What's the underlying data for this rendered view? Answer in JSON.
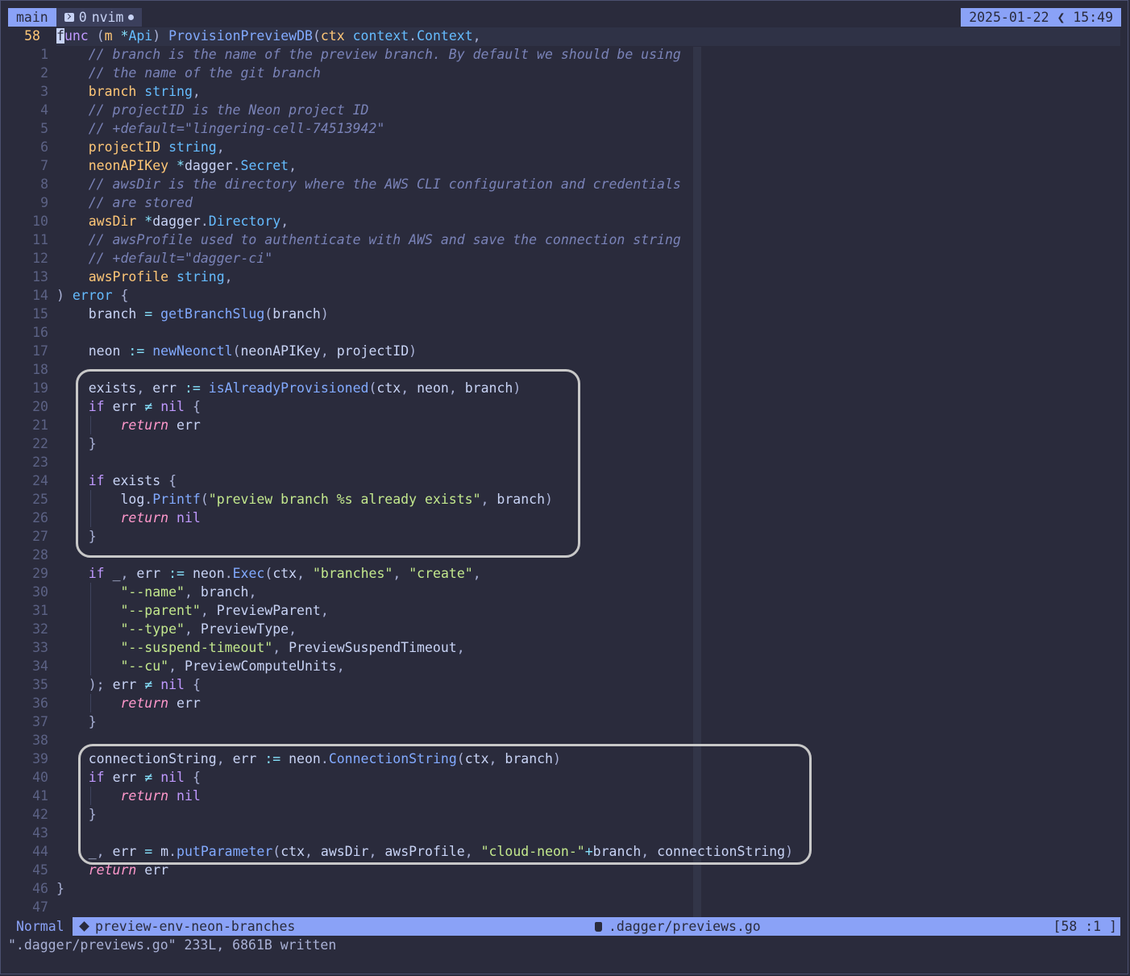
{
  "tmux": {
    "session": "main",
    "window_index": "0",
    "window_name": "nvim",
    "clock": "2025-01-22 ❮ 15:49"
  },
  "editor": {
    "lines": [
      {
        "n": "58",
        "tokens": [
          [
            "cursor",
            "f"
          ],
          [
            "kw",
            "unc "
          ],
          [
            "pu",
            "("
          ],
          [
            "pm",
            "m "
          ],
          [
            "op",
            "*"
          ],
          [
            "ty",
            "Api"
          ],
          [
            "pu",
            ") "
          ],
          [
            "fn",
            "ProvisionPreviewDB"
          ],
          [
            "pu",
            "("
          ],
          [
            "pm",
            "ctx "
          ],
          [
            "ty",
            "context"
          ],
          [
            "pu",
            "."
          ],
          [
            "ty",
            "Context"
          ],
          [
            "pu",
            ","
          ]
        ]
      },
      {
        "n": "1",
        "tokens": [
          [
            "",
            "    "
          ],
          [
            "cm",
            "// branch is the name of the preview branch. By default we should be using"
          ]
        ]
      },
      {
        "n": "2",
        "tokens": [
          [
            "",
            "    "
          ],
          [
            "cm",
            "// the name of the git branch"
          ]
        ]
      },
      {
        "n": "3",
        "tokens": [
          [
            "",
            "    "
          ],
          [
            "pm",
            "branch "
          ],
          [
            "ty",
            "string"
          ],
          [
            "pu",
            ","
          ]
        ]
      },
      {
        "n": "4",
        "tokens": [
          [
            "",
            "    "
          ],
          [
            "cm",
            "// projectID is the Neon project ID"
          ]
        ]
      },
      {
        "n": "5",
        "tokens": [
          [
            "",
            "    "
          ],
          [
            "cm",
            "// +default=\"lingering-cell-74513942\""
          ]
        ]
      },
      {
        "n": "6",
        "tokens": [
          [
            "",
            "    "
          ],
          [
            "pm",
            "projectID "
          ],
          [
            "ty",
            "string"
          ],
          [
            "pu",
            ","
          ]
        ]
      },
      {
        "n": "7",
        "tokens": [
          [
            "",
            "    "
          ],
          [
            "pm",
            "neonAPIKey "
          ],
          [
            "op",
            "*"
          ],
          [
            "",
            "dagger"
          ],
          [
            "pu",
            "."
          ],
          [
            "ty",
            "Secret"
          ],
          [
            "pu",
            ","
          ]
        ]
      },
      {
        "n": "8",
        "tokens": [
          [
            "",
            "    "
          ],
          [
            "cm",
            "// awsDir is the directory where the AWS CLI configuration and credentials"
          ]
        ]
      },
      {
        "n": "9",
        "tokens": [
          [
            "",
            "    "
          ],
          [
            "cm",
            "// are stored"
          ]
        ]
      },
      {
        "n": "10",
        "tokens": [
          [
            "",
            "    "
          ],
          [
            "pm",
            "awsDir "
          ],
          [
            "op",
            "*"
          ],
          [
            "",
            "dagger"
          ],
          [
            "pu",
            "."
          ],
          [
            "ty",
            "Directory"
          ],
          [
            "pu",
            ","
          ]
        ]
      },
      {
        "n": "11",
        "tokens": [
          [
            "",
            "    "
          ],
          [
            "cm",
            "// awsProfile used to authenticate with AWS and save the connection string"
          ]
        ]
      },
      {
        "n": "12",
        "tokens": [
          [
            "",
            "    "
          ],
          [
            "cm",
            "// +default=\"dagger-ci\""
          ]
        ]
      },
      {
        "n": "13",
        "tokens": [
          [
            "",
            "    "
          ],
          [
            "pm",
            "awsProfile "
          ],
          [
            "ty",
            "string"
          ],
          [
            "pu",
            ","
          ]
        ]
      },
      {
        "n": "14",
        "tokens": [
          [
            "pu",
            ") "
          ],
          [
            "ty",
            "error "
          ],
          [
            "pu",
            "{"
          ]
        ]
      },
      {
        "n": "15",
        "tokens": [
          [
            "",
            "    branch "
          ],
          [
            "op",
            "= "
          ],
          [
            "fn",
            "getBranchSlug"
          ],
          [
            "pu",
            "("
          ],
          [
            "",
            "branch"
          ],
          [
            "pu",
            ")"
          ]
        ]
      },
      {
        "n": "16",
        "tokens": []
      },
      {
        "n": "17",
        "tokens": [
          [
            "",
            "    neon "
          ],
          [
            "op",
            ":= "
          ],
          [
            "fn",
            "newNeonctl"
          ],
          [
            "pu",
            "("
          ],
          [
            "",
            "neonAPIKey"
          ],
          [
            "pu",
            ", "
          ],
          [
            "",
            "projectID"
          ],
          [
            "pu",
            ")"
          ]
        ]
      },
      {
        "n": "18",
        "tokens": []
      },
      {
        "n": "19",
        "tokens": [
          [
            "",
            "    exists"
          ],
          [
            "pu",
            ", "
          ],
          [
            "",
            "err "
          ],
          [
            "op",
            ":= "
          ],
          [
            "fn",
            "isAlreadyProvisioned"
          ],
          [
            "pu",
            "("
          ],
          [
            "",
            "ctx"
          ],
          [
            "pu",
            ", "
          ],
          [
            "",
            "neon"
          ],
          [
            "pu",
            ", "
          ],
          [
            "",
            "branch"
          ],
          [
            "pu",
            ")"
          ]
        ]
      },
      {
        "n": "20",
        "tokens": [
          [
            "",
            "    "
          ],
          [
            "kw",
            "if "
          ],
          [
            "",
            "err "
          ],
          [
            "op",
            "≠ "
          ],
          [
            "nl",
            "nil "
          ],
          [
            "pu",
            "{"
          ]
        ]
      },
      {
        "n": "21",
        "tokens": [
          [
            "",
            "        "
          ],
          [
            "kwi",
            "return "
          ],
          [
            "",
            "err"
          ]
        ]
      },
      {
        "n": "22",
        "tokens": [
          [
            "",
            "    "
          ],
          [
            "pu",
            "}"
          ]
        ]
      },
      {
        "n": "23",
        "tokens": []
      },
      {
        "n": "24",
        "tokens": [
          [
            "",
            "    "
          ],
          [
            "kw",
            "if "
          ],
          [
            "",
            "exists "
          ],
          [
            "pu",
            "{"
          ]
        ]
      },
      {
        "n": "25",
        "tokens": [
          [
            "",
            "        log"
          ],
          [
            "pu",
            "."
          ],
          [
            "fn",
            "Printf"
          ],
          [
            "pu",
            "("
          ],
          [
            "st",
            "\"preview branch %s already exists\""
          ],
          [
            "pu",
            ", "
          ],
          [
            "",
            "branch"
          ],
          [
            "pu",
            ")"
          ]
        ]
      },
      {
        "n": "26",
        "tokens": [
          [
            "",
            "        "
          ],
          [
            "kwi",
            "return "
          ],
          [
            "nl",
            "nil"
          ]
        ]
      },
      {
        "n": "27",
        "tokens": [
          [
            "",
            "    "
          ],
          [
            "pu",
            "}"
          ]
        ]
      },
      {
        "n": "28",
        "tokens": []
      },
      {
        "n": "29",
        "tokens": [
          [
            "",
            "    "
          ],
          [
            "kw",
            "if "
          ],
          [
            "",
            "_"
          ],
          [
            "pu",
            ", "
          ],
          [
            "",
            "err "
          ],
          [
            "op",
            ":= "
          ],
          [
            "",
            "neon"
          ],
          [
            "pu",
            "."
          ],
          [
            "fn",
            "Exec"
          ],
          [
            "pu",
            "("
          ],
          [
            "",
            "ctx"
          ],
          [
            "pu",
            ", "
          ],
          [
            "st",
            "\"branches\""
          ],
          [
            "pu",
            ", "
          ],
          [
            "st",
            "\"create\""
          ],
          [
            "pu",
            ","
          ]
        ]
      },
      {
        "n": "30",
        "tokens": [
          [
            "",
            "        "
          ],
          [
            "st",
            "\"--name\""
          ],
          [
            "pu",
            ", "
          ],
          [
            "",
            "branch"
          ],
          [
            "pu",
            ","
          ]
        ]
      },
      {
        "n": "31",
        "tokens": [
          [
            "",
            "        "
          ],
          [
            "st",
            "\"--parent\""
          ],
          [
            "pu",
            ", "
          ],
          [
            "",
            "PreviewParent"
          ],
          [
            "pu",
            ","
          ]
        ]
      },
      {
        "n": "32",
        "tokens": [
          [
            "",
            "        "
          ],
          [
            "st",
            "\"--type\""
          ],
          [
            "pu",
            ", "
          ],
          [
            "",
            "PreviewType"
          ],
          [
            "pu",
            ","
          ]
        ]
      },
      {
        "n": "33",
        "tokens": [
          [
            "",
            "        "
          ],
          [
            "st",
            "\"--suspend-timeout\""
          ],
          [
            "pu",
            ", "
          ],
          [
            "",
            "PreviewSuspendTimeout"
          ],
          [
            "pu",
            ","
          ]
        ]
      },
      {
        "n": "34",
        "tokens": [
          [
            "",
            "        "
          ],
          [
            "st",
            "\"--cu\""
          ],
          [
            "pu",
            ", "
          ],
          [
            "",
            "PreviewComputeUnits"
          ],
          [
            "pu",
            ","
          ]
        ]
      },
      {
        "n": "35",
        "tokens": [
          [
            "",
            "    "
          ],
          [
            "pu",
            "); "
          ],
          [
            "",
            "err "
          ],
          [
            "op",
            "≠ "
          ],
          [
            "nl",
            "nil "
          ],
          [
            "pu",
            "{"
          ]
        ]
      },
      {
        "n": "36",
        "tokens": [
          [
            "",
            "        "
          ],
          [
            "kwi",
            "return "
          ],
          [
            "",
            "err"
          ]
        ]
      },
      {
        "n": "37",
        "tokens": [
          [
            "",
            "    "
          ],
          [
            "pu",
            "}"
          ]
        ]
      },
      {
        "n": "38",
        "tokens": []
      },
      {
        "n": "39",
        "tokens": [
          [
            "",
            "    connectionString"
          ],
          [
            "pu",
            ", "
          ],
          [
            "",
            "err "
          ],
          [
            "op",
            ":= "
          ],
          [
            "",
            "neon"
          ],
          [
            "pu",
            "."
          ],
          [
            "fn",
            "ConnectionString"
          ],
          [
            "pu",
            "("
          ],
          [
            "",
            "ctx"
          ],
          [
            "pu",
            ", "
          ],
          [
            "",
            "branch"
          ],
          [
            "pu",
            ")"
          ]
        ]
      },
      {
        "n": "40",
        "tokens": [
          [
            "",
            "    "
          ],
          [
            "kw",
            "if "
          ],
          [
            "",
            "err "
          ],
          [
            "op",
            "≠ "
          ],
          [
            "nl",
            "nil "
          ],
          [
            "pu",
            "{"
          ]
        ]
      },
      {
        "n": "41",
        "tokens": [
          [
            "",
            "        "
          ],
          [
            "kwi",
            "return "
          ],
          [
            "nl",
            "nil"
          ]
        ]
      },
      {
        "n": "42",
        "tokens": [
          [
            "",
            "    "
          ],
          [
            "pu",
            "}"
          ]
        ]
      },
      {
        "n": "43",
        "tokens": []
      },
      {
        "n": "44",
        "tokens": [
          [
            "",
            "    _"
          ],
          [
            "pu",
            ", "
          ],
          [
            "",
            "err "
          ],
          [
            "op",
            "= "
          ],
          [
            "",
            "m"
          ],
          [
            "pu",
            "."
          ],
          [
            "fn",
            "putParameter"
          ],
          [
            "pu",
            "("
          ],
          [
            "",
            "ctx"
          ],
          [
            "pu",
            ", "
          ],
          [
            "",
            "awsDir"
          ],
          [
            "pu",
            ", "
          ],
          [
            "",
            "awsProfile"
          ],
          [
            "pu",
            ", "
          ],
          [
            "st",
            "\"cloud-neon-\""
          ],
          [
            "op",
            "+"
          ],
          [
            "",
            "branch"
          ],
          [
            "pu",
            ", "
          ],
          [
            "",
            "connectionString"
          ],
          [
            "pu",
            ")"
          ]
        ]
      },
      {
        "n": "45",
        "tokens": [
          [
            "",
            "    "
          ],
          [
            "kwi",
            "return "
          ],
          [
            "",
            "err"
          ]
        ]
      },
      {
        "n": "46",
        "tokens": [
          [
            "pu",
            "}"
          ]
        ]
      },
      {
        "n": "47",
        "tokens": []
      }
    ]
  },
  "statusline": {
    "mode": "Normal",
    "branch": "preview-env-neon-branches",
    "file": ".dagger/previews.go",
    "position": "[58 :1 ]"
  },
  "cmdline": "\".dagger/previews.go\" 233L, 6861B written",
  "icons": {
    "window": "terminal-icon",
    "branch": "git-branch-icon",
    "file": "file-icon"
  }
}
